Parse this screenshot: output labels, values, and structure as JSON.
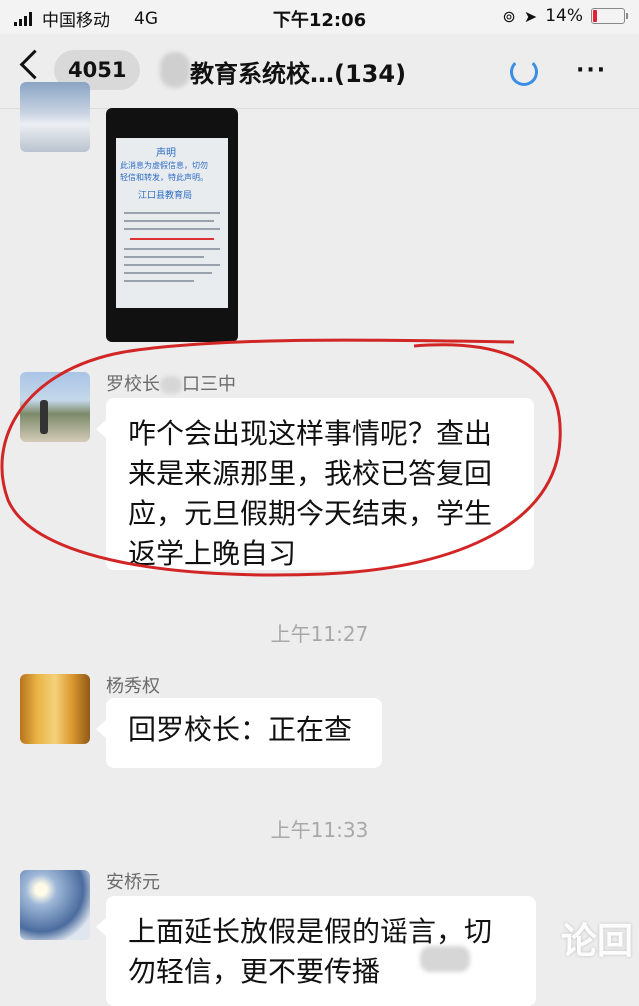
{
  "status_bar": {
    "carrier": "中国移动",
    "network": "4G",
    "time": "下午12:06",
    "battery": "14%",
    "battery_level": 0.14,
    "battery_color": "#e22233"
  },
  "nav": {
    "back_icon": "chevron-left-icon",
    "unread_count": "4051",
    "title": "教育系统校…(134)",
    "loading_icon": "spinner-icon",
    "more_icon": "more-icon"
  },
  "messages": [
    {
      "type": "image",
      "image_texts": [
        "声明",
        "此消息为虚假信息，切勿",
        "轻信和转发，特此声明。",
        "江口县教育局"
      ]
    },
    {
      "sender": "罗校长",
      "sender_suffix": "口三中",
      "text": "咋个会出现这样事情呢？查出来是来源那里，我校已答复回应，元旦假期今天结束，学生返学上晚自习"
    },
    {
      "timestamp": "上午11:27"
    },
    {
      "sender": "杨秀权",
      "text": "回罗校长：正在查"
    },
    {
      "timestamp": "上午11:33"
    },
    {
      "sender": "安桥元",
      "text": "上面延长放假是假的谣言，切勿轻信，更不要传播"
    }
  ],
  "watermark": "论回",
  "annotation_color": "#d22525"
}
